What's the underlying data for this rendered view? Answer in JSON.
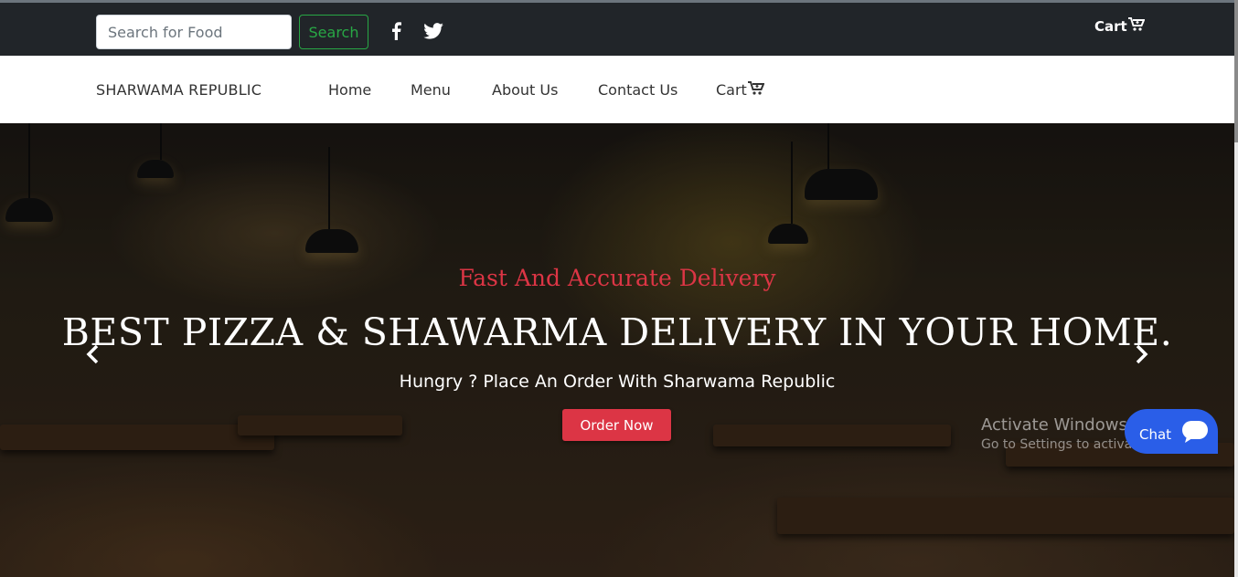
{
  "topbar": {
    "search_placeholder": "Search for Food",
    "search_label": "Search",
    "cart_label": "Cart",
    "icons": [
      "facebook-icon",
      "twitter-icon",
      "cart-icon"
    ]
  },
  "navbar": {
    "brand": "SHARWAMA REPUBLIC",
    "items": [
      {
        "label": "Home"
      },
      {
        "label": "Menu"
      },
      {
        "label": "About Us"
      },
      {
        "label": "Contact Us"
      },
      {
        "label": "Cart"
      }
    ]
  },
  "hero": {
    "subtitle": "Fast And Accurate Delivery",
    "headline": "BEST PIZZA & SHAWARMA DELIVERY IN YOUR HOME.",
    "tagline": "Hungry ? Place An Order With Sharwama Republic",
    "cta_label": "Order Now",
    "icons": [
      "chevron-left-icon",
      "chevron-right-icon"
    ]
  },
  "overlay": {
    "activate_title": "Activate Windows",
    "activate_sub": "Go to Settings to activate Windows.",
    "chat_label": "Chat"
  },
  "colors": {
    "topbar_bg": "#212529",
    "accent_red": "#dc3545",
    "search_green": "#28a745",
    "chat_blue": "#2a5ee8"
  }
}
